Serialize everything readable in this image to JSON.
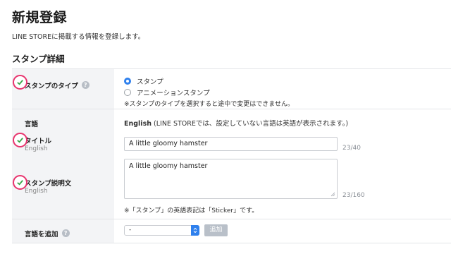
{
  "header": {
    "title": "新規登録",
    "subtitle": "LINE STOREに掲載する情報を登録します。"
  },
  "section": {
    "title": "スタンプ詳細"
  },
  "sticker_type": {
    "label": "スタンプのタイプ",
    "options": [
      "スタンプ",
      "アニメーションスタンプ"
    ],
    "selected": "スタンプ",
    "note": "※スタンプのタイプを選択すると途中で変更はできません。"
  },
  "language": {
    "label": "言語",
    "value_strong": "English",
    "value_note": "(LINE STOREでは、設定していない言語は英語が表示されます。)"
  },
  "title_field": {
    "label": "タイトル",
    "sublabel": "English",
    "value": "A little gloomy hamster",
    "counter": "23/40"
  },
  "description_field": {
    "label": "スタンプ説明文",
    "sublabel": "English",
    "value": "A little gloomy hamster",
    "counter": "23/160",
    "note": "※「スタンプ」の英語表記は「Sticker」です。"
  },
  "add_language": {
    "label": "言語を追加",
    "select_value": "-",
    "button": "追加"
  },
  "colors": {
    "accent": "#2f80ed",
    "check_ring": "#e8336d",
    "check_mark": "#3aa64a",
    "label_bg": "#f3f4f6"
  }
}
